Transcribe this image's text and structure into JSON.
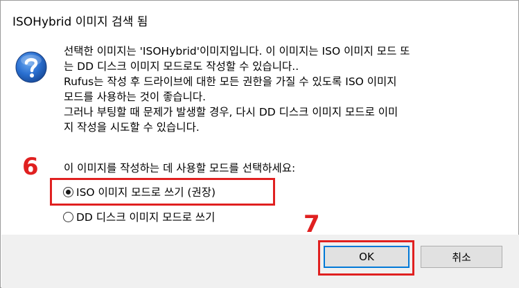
{
  "dialog": {
    "title": "ISOHybrid 이미지 검색 됨",
    "icon": "question-icon",
    "message_lines": [
      "선택한 이미지는 'ISOHybrid'이미지입니다. 이 이미지는 ISO 이미지 모드 또",
      "는 DD 디스크 이미지 모드로도 작성할 수 있습니다..",
      "Rufus는 작성 후 드라이브에 대한 모든 권한을 가질 수 있도록 ISO 이미지",
      "모드를 사용하는 것이 좋습니다.",
      "그러나 부팅할 때 문제가 발생할 경우, 다시 DD 디스크 이미지 모드로 이미",
      "지 작성을 시도할 수 있습니다."
    ],
    "prompt": "이 이미지를 작성하는 데 사용할 모드를 선택하세요:",
    "options": [
      {
        "label": "ISO 이미지 모드로 쓰기 (권장)",
        "selected": true
      },
      {
        "label": "DD 디스크 이미지 모드로 쓰기",
        "selected": false
      }
    ],
    "buttons": {
      "ok": "OK",
      "cancel": "취소"
    }
  },
  "annotations": {
    "step_6": "6",
    "step_7": "7",
    "highlight_color": "#e02020"
  }
}
